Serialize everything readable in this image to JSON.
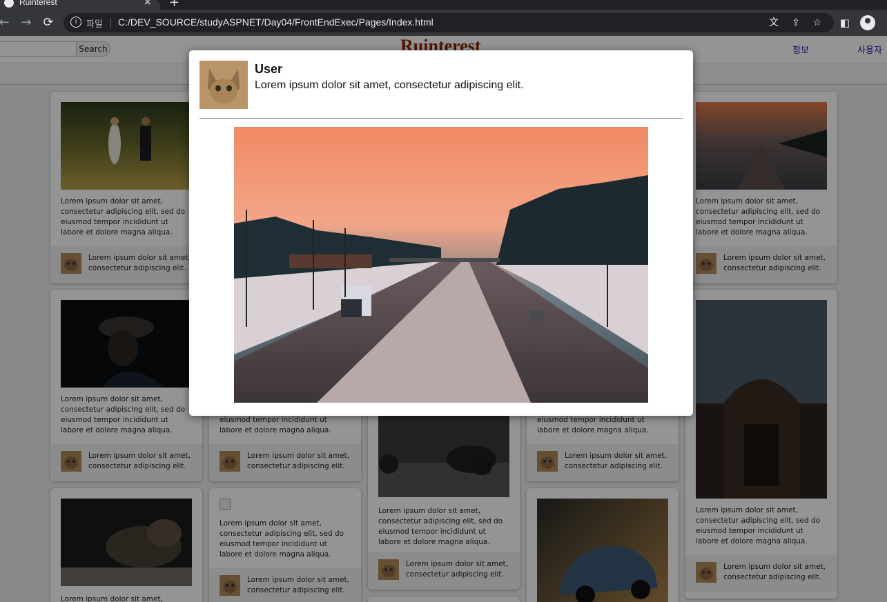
{
  "browser": {
    "tab_title": "Ruinterest",
    "url_scheme": "파일",
    "url": "C:/DEV_SOURCE/studyASPNET/Day04/FrontEndExec/Pages/Index.html"
  },
  "header": {
    "search_button": "Search",
    "brand": "Ruinterest",
    "nav": [
      "정보",
      "사용자"
    ]
  },
  "cards": {
    "body_text": "Lorem ipsum dolor sit amet, consectetur adipiscing elit, sed do eiusmod tempor incididunt ut labore et dolore magna aliqua.",
    "partial_text": "eiusmod tempor incididunt ut labore et dolore magna aliqua.",
    "clipped_text": "Lorem ipsum dolor sit amet,",
    "footer_text": "Lorem ipsum dolor sit amet, consectetur adipiscing elit."
  },
  "modal": {
    "user_name": "User",
    "description": "Lorem ipsum dolor sit amet, consectetur adipiscing elit."
  },
  "colors": {
    "brand": "#8b2500",
    "nav_link": "#1a0dab",
    "overlay": "rgba(0,0,0,0.42)"
  }
}
